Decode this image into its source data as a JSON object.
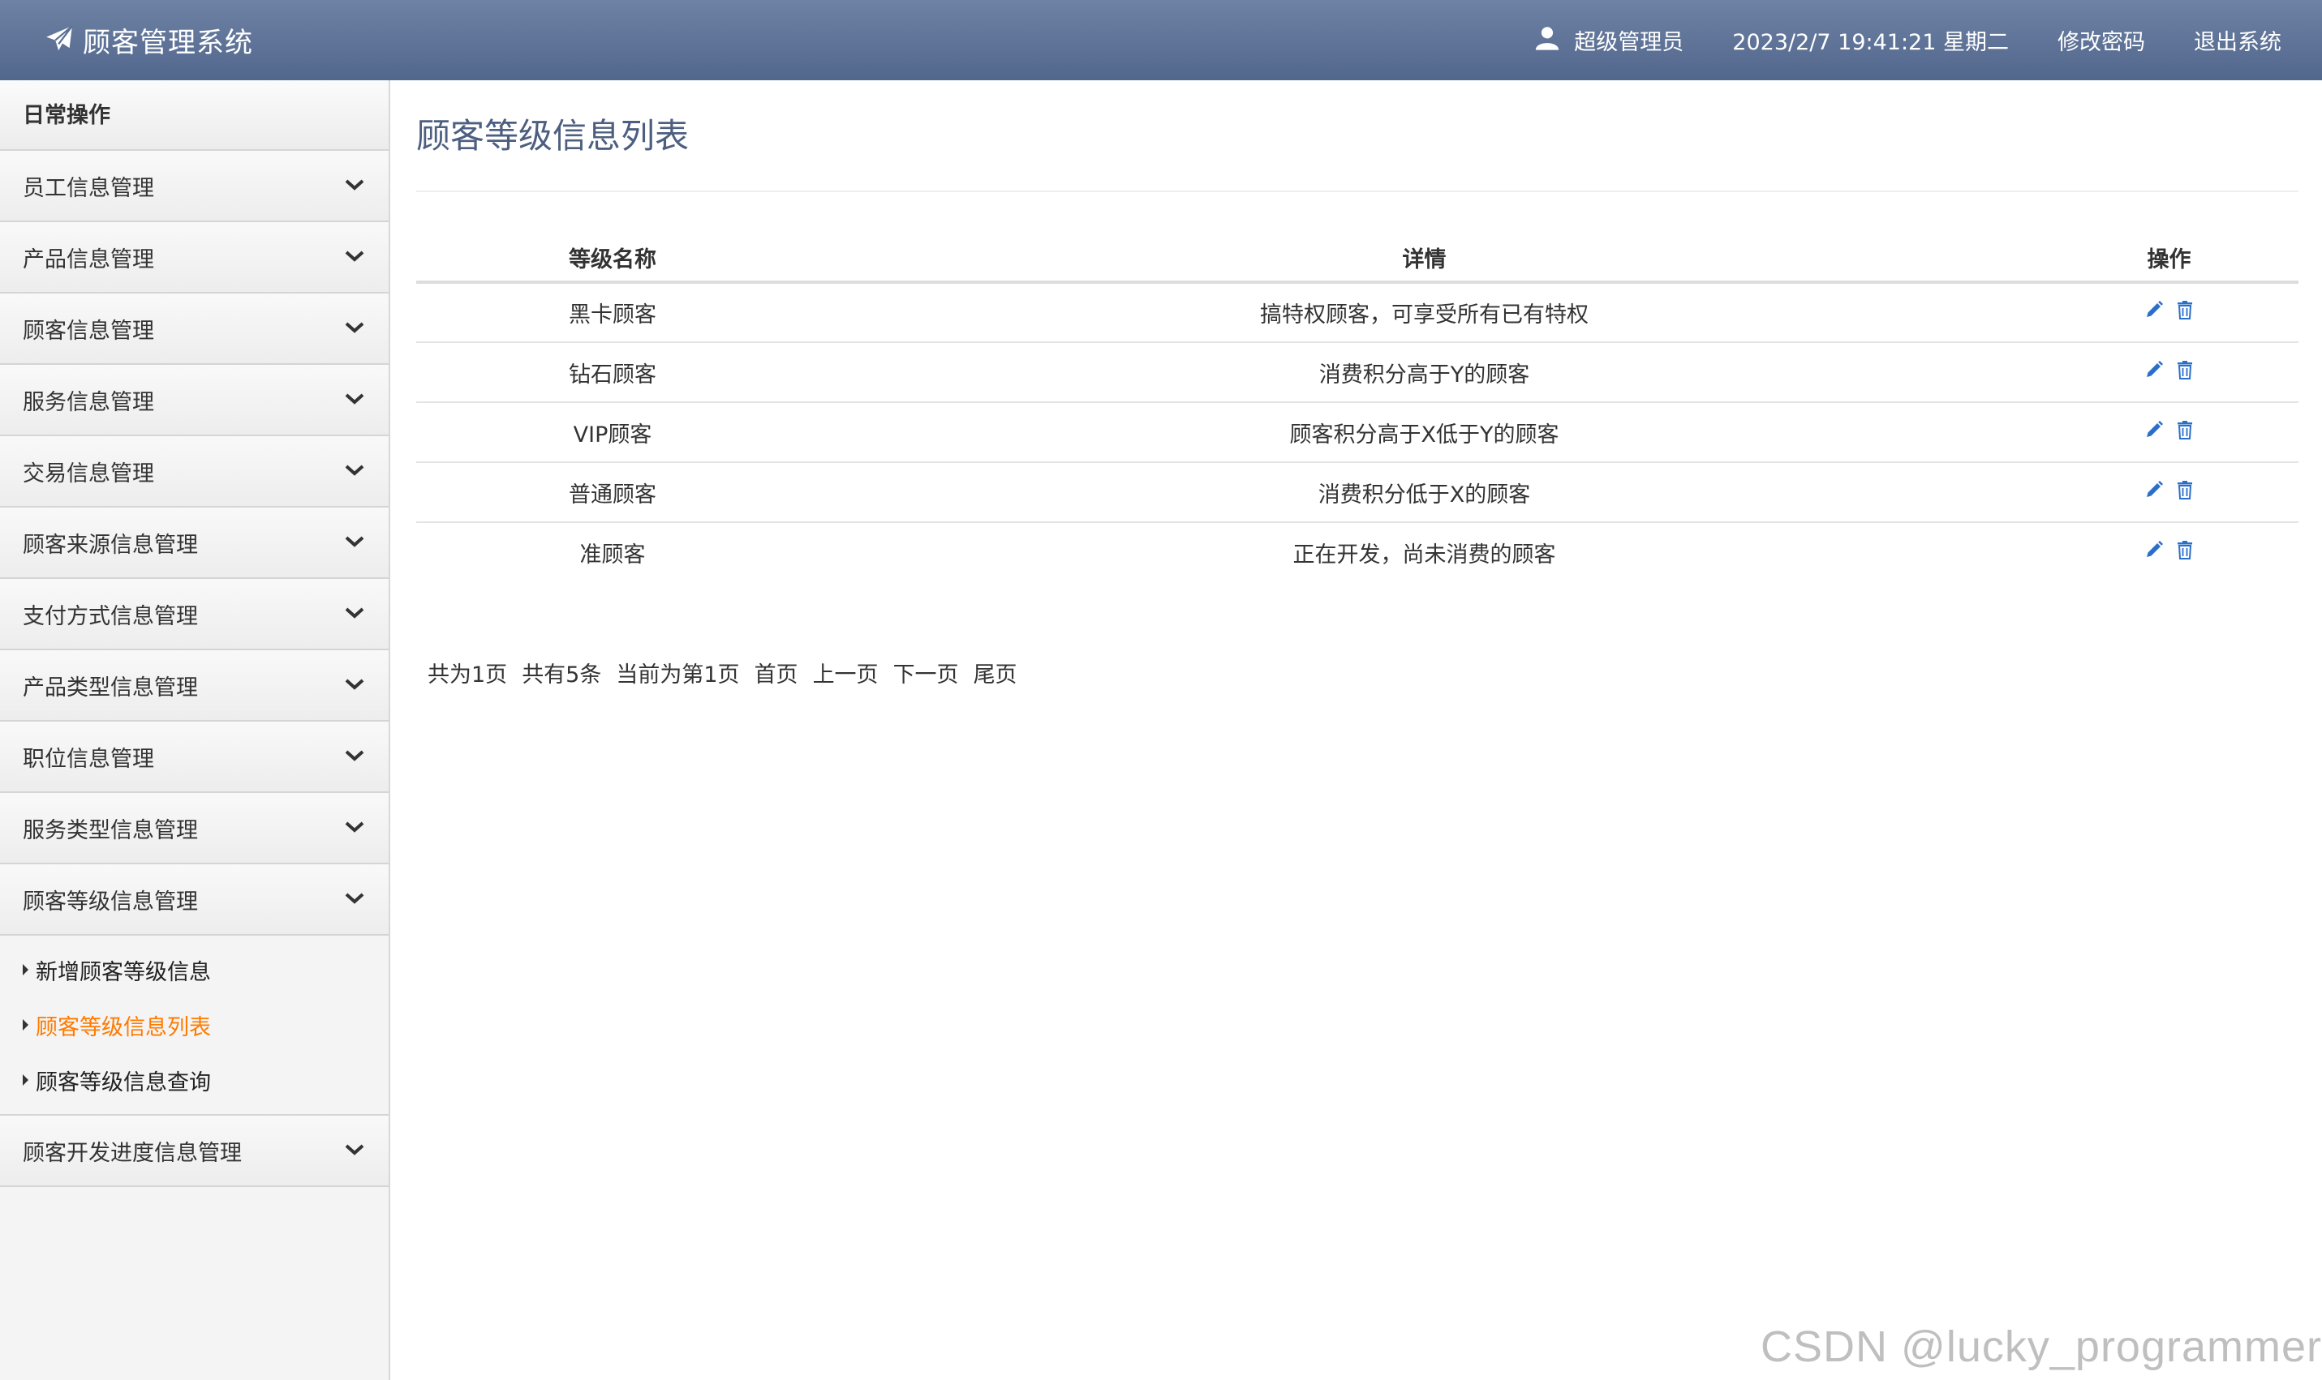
{
  "header": {
    "app_title": "顾客管理系统",
    "user_name": "超级管理员",
    "datetime": "2023/2/7 19:41:21 星期二",
    "change_password": "修改密码",
    "logout": "退出系统"
  },
  "sidebar": {
    "heading": "日常操作",
    "groups": [
      {
        "label": "员工信息管理"
      },
      {
        "label": "产品信息管理"
      },
      {
        "label": "顾客信息管理"
      },
      {
        "label": "服务信息管理"
      },
      {
        "label": "交易信息管理"
      },
      {
        "label": "顾客来源信息管理"
      },
      {
        "label": "支付方式信息管理"
      },
      {
        "label": "产品类型信息管理"
      },
      {
        "label": "职位信息管理"
      },
      {
        "label": "服务类型信息管理"
      },
      {
        "label": "顾客等级信息管理"
      },
      {
        "label": "顾客开发进度信息管理"
      }
    ],
    "sub_items": [
      {
        "label": "新增顾客等级信息"
      },
      {
        "label": "顾客等级信息列表",
        "active": true
      },
      {
        "label": "顾客等级信息查询"
      }
    ]
  },
  "main": {
    "title": "顾客等级信息列表",
    "columns": {
      "name": "等级名称",
      "detail": "详情",
      "ops": "操作"
    },
    "rows": [
      {
        "name": "黑卡顾客",
        "detail": "搞特权顾客，可享受所有已有特权"
      },
      {
        "name": "钻石顾客",
        "detail": "消费积分高于Y的顾客"
      },
      {
        "name": "VIP顾客",
        "detail": "顾客积分高于X低于Y的顾客"
      },
      {
        "name": "普通顾客",
        "detail": "消费积分低于X的顾客"
      },
      {
        "name": "准顾客",
        "detail": "正在开发，尚未消费的顾客"
      }
    ],
    "pager": {
      "total_pages": "共为1页",
      "total_records": "共有5条",
      "current": "当前为第1页",
      "first": "首页",
      "prev": "上一页",
      "next": "下一页",
      "last": "尾页"
    }
  },
  "watermark": "CSDN @lucky_programmer",
  "icons": {
    "brand": "paper-plane-icon",
    "user": "user-icon",
    "expand": "chevron-down-icon",
    "edit": "pencil-icon",
    "delete": "trash-icon"
  },
  "colors": {
    "header_top": "#6e82a5",
    "header_bottom": "#52678c",
    "active_link": "#ff7a00",
    "title": "#4d5f80",
    "action_icon": "#2a6fc9"
  }
}
